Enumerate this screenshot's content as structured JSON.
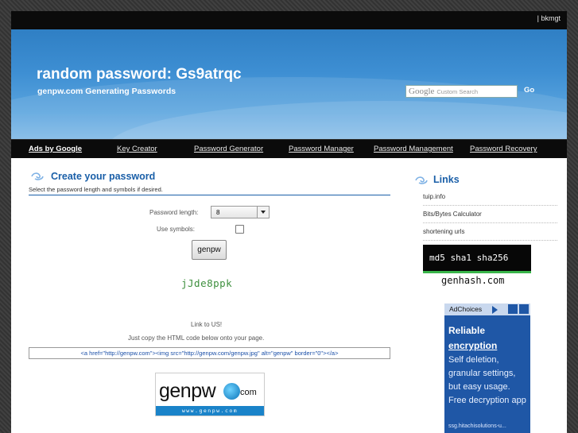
{
  "topbar": {
    "user": "| bkmgt"
  },
  "header": {
    "title": "random password: Gs9atrqc",
    "subtitle": "genpw.com Generating Passwords",
    "search": {
      "logo": "Google",
      "placeholder": "Custom Search"
    },
    "go_label": "Go"
  },
  "nav": {
    "items": [
      {
        "label": "Ads by Google"
      },
      {
        "label": "Key Creator"
      },
      {
        "label": "Password Generator"
      },
      {
        "label": "Password Manager"
      },
      {
        "label": "Password Management"
      },
      {
        "label": "Password Recovery"
      }
    ]
  },
  "main": {
    "heading": "Create your password",
    "description": "Select the password length and symbols if desired.",
    "length_label": "Password length:",
    "length_value": "8",
    "symbols_label": "Use symbols:",
    "symbols_checked": false,
    "button_label": "genpw",
    "generated_password": "jJde8ppk",
    "link_heading": "Link to US!",
    "link_instruction": "Just copy the HTML code below onto your page.",
    "link_code": "<a href=\"http://genpw.com\"><img src=\"http://genpw.com/genpw.jpg\" alt=\"genpw\" border=\"0\"></a>",
    "logo": {
      "word": "genpw",
      "suffix": "com",
      "url": "www.genpw.com"
    }
  },
  "sidebar": {
    "heading": "Links",
    "links": [
      {
        "label": "tuip.info"
      },
      {
        "label": "Bits/Bytes Calculator"
      },
      {
        "label": "shortening urls"
      }
    ],
    "md5_banner": "md5 sha1 sha256",
    "genhash": "genhash.com",
    "ad": {
      "choices_label": "AdChoices",
      "title_line1": "Reliable",
      "title_line2": "encryption",
      "body": "Self deletion, granular settings, but easy usage. Free decryption app",
      "source": "ssg.hitachisolutions-u..."
    }
  },
  "colors": {
    "accent": "#1a5fa8",
    "header_blue": "#3e8fd3",
    "password_green": "#3d8f3d",
    "bar_black": "#0b0b0b"
  }
}
